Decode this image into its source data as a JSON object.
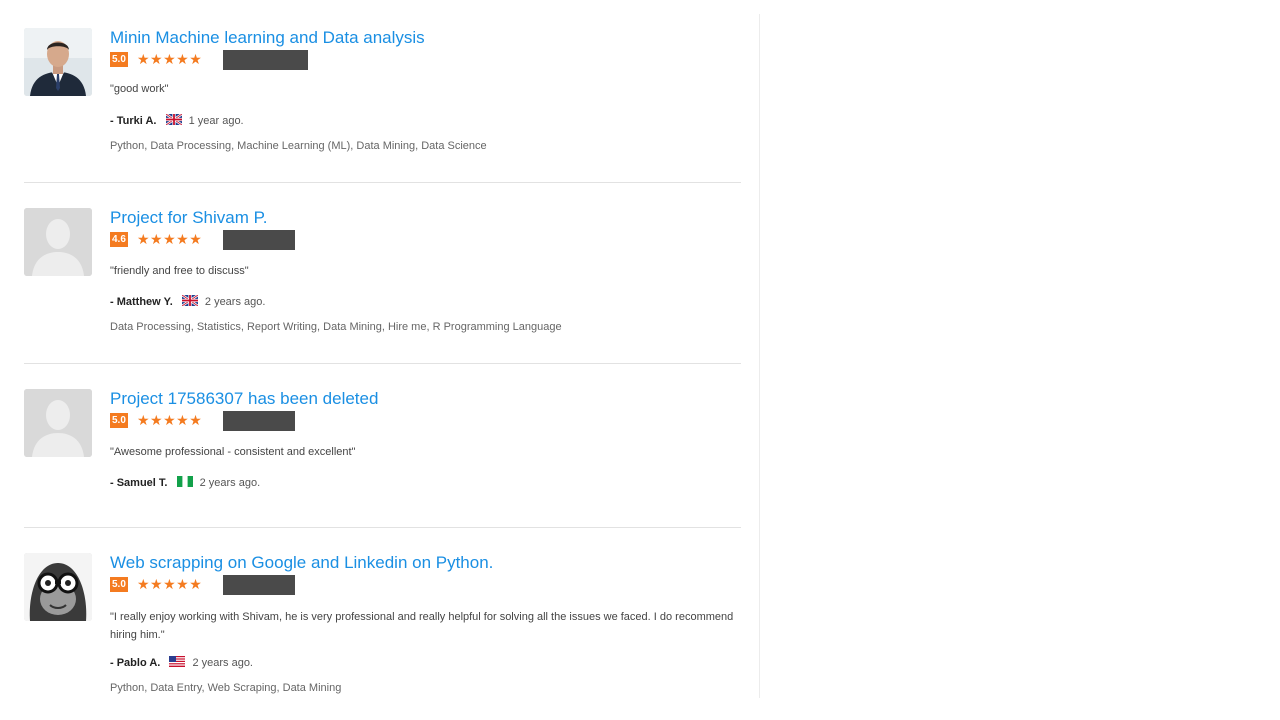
{
  "reviews": [
    {
      "title": "Minin Machine learning and Data analysis",
      "score": "5.0",
      "stars": "★★★★★",
      "quote": "\"good work\"",
      "author": "- Turki A.",
      "time": "1 year ago.",
      "skills": "Python, Data Processing, Machine Learning (ML), Data Mining, Data Science"
    },
    {
      "title": "Project for Shivam P.",
      "score": "4.6",
      "stars": "★★★★★",
      "quote": "\"friendly and free to discuss\"",
      "author": "- Matthew Y.",
      "time": "2 years ago.",
      "skills": "Data Processing, Statistics, Report Writing, Data Mining, Hire me, R Programming Language"
    },
    {
      "title": "Project 17586307 has been deleted",
      "score": "5.0",
      "stars": "★★★★★",
      "quote": "\"Awesome professional - consistent and excellent\"",
      "author": "- Samuel T.",
      "time": "2 years ago."
    },
    {
      "title": "Web scrapping on Google and Linkedin on Python.",
      "score": "5.0",
      "stars": "★★★★★",
      "quote": "\"I really enjoy working with Shivam, he is very professional and really helpful for solving all the issues we faced. I do recommend hiring him.\"",
      "author": "- Pablo A.",
      "time": "2 years ago.",
      "skills": "Python, Data Entry, Web Scraping, Data Mining"
    }
  ],
  "colors": {
    "link": "#1a8fe3",
    "rating": "#f47b20",
    "redaction": "#4a4a4a"
  },
  "icons": [
    "person-photo-avatar",
    "default-avatar",
    "uk-flag-icon",
    "nigeria-flag-icon",
    "us-flag-icon",
    "monkey-avatar"
  ]
}
